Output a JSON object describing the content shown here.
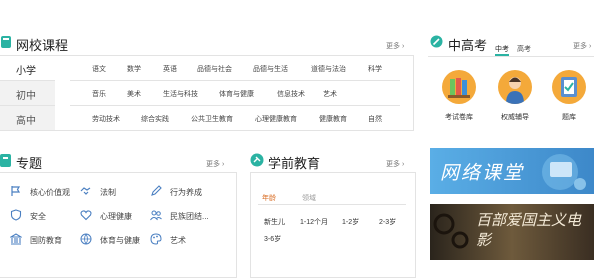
{
  "courses": {
    "title": "网校课程",
    "more": "更多 ›",
    "stages": [
      "小学",
      "初中",
      "高中"
    ],
    "subjects": {
      "row1": [
        "语文",
        "数学",
        "英语",
        "品德与社会",
        "品德与生活",
        "道德与法治",
        "科学"
      ],
      "row2": [
        "音乐",
        "美术",
        "生活与科技",
        "体育与健康",
        "信息技术",
        "艺术"
      ],
      "row3": [
        "劳动技术",
        "综合实践",
        "公共卫生教育",
        "心理健康教育",
        "健康教育",
        "自然"
      ]
    }
  },
  "exam": {
    "title": "中高考",
    "tabs": [
      "中考",
      "高考"
    ],
    "more": "更多 ›",
    "items": [
      "考试卷库",
      "权威辅导",
      "题库"
    ]
  },
  "topics": {
    "title": "专题",
    "more": "更多 ›",
    "items": [
      {
        "label": "核心价值观",
        "icon": "flag-icon"
      },
      {
        "label": "法制",
        "icon": "handshake-icon"
      },
      {
        "label": "行为养成",
        "icon": "pencil-icon"
      },
      {
        "label": "安全",
        "icon": "shield-icon"
      },
      {
        "label": "心理健康",
        "icon": "heart-icon"
      },
      {
        "label": "民族团结...",
        "icon": "people-icon"
      },
      {
        "label": "国防教育",
        "icon": "building-icon"
      },
      {
        "label": "体育与健康",
        "icon": "ball-icon"
      },
      {
        "label": "艺术",
        "icon": "palette-icon"
      }
    ]
  },
  "preschool": {
    "title": "学前教育",
    "more": "更多 ›",
    "tabs": [
      "年龄",
      "领域"
    ],
    "ages": [
      "新生儿",
      "1-12个月",
      "1-2岁",
      "2-3岁",
      "3-6岁"
    ]
  },
  "banners": {
    "online": "网络课堂",
    "patriotic": "百部爱国主义电影"
  },
  "colors": {
    "accent": "#2bb3a3",
    "active_stage_bg": "#ffffff",
    "inactive_stage_bg": "#f2f2f2",
    "banner_blue": "#4a9fd8"
  }
}
